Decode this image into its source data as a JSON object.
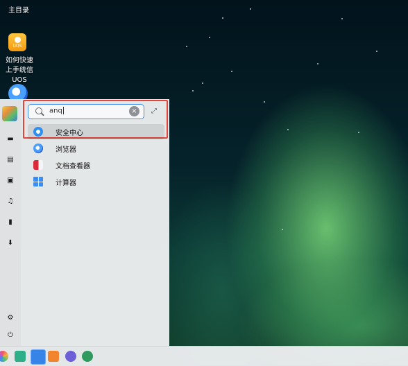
{
  "desktop": {
    "home_label": "主目录",
    "uos_icon_text": "UOS",
    "guide_label": "如何快速上手统信UOS"
  },
  "launcher": {
    "search": {
      "value": "anq"
    },
    "results": [
      {
        "label": "安全中心",
        "icon": "security-center-icon",
        "selected": true
      },
      {
        "label": "浏览器",
        "icon": "browser-icon",
        "selected": false
      },
      {
        "label": "文档查看器",
        "icon": "document-viewer-icon",
        "selected": false
      },
      {
        "label": "计算器",
        "icon": "calculator-icon",
        "selected": false
      }
    ],
    "rail_icons": [
      "computer-icon",
      "document-icon",
      "picture-icon",
      "music-icon",
      "video-icon",
      "download-icon",
      "settings-icon",
      "power-icon"
    ]
  },
  "colors": {
    "accent": "#3f8cf0",
    "highlight_border": "#e0463b"
  }
}
